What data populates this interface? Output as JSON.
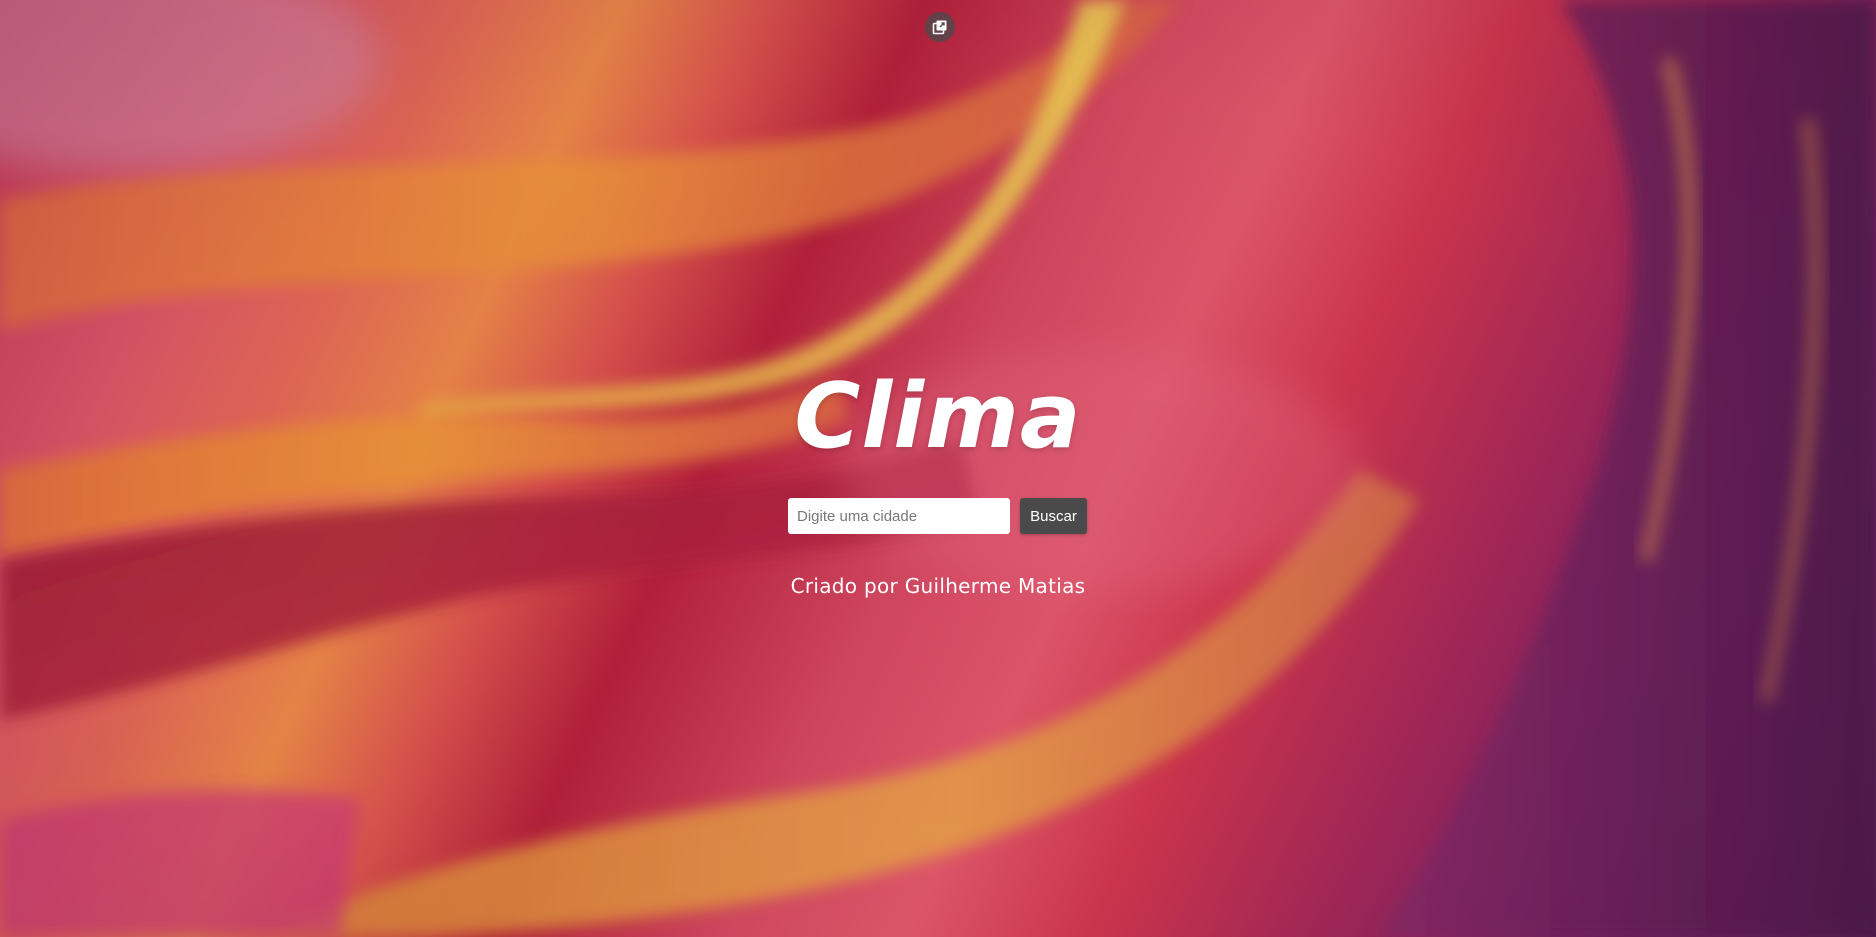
{
  "app": {
    "title": "Clima"
  },
  "search": {
    "placeholder": "Digite uma cidade",
    "value": "",
    "button_label": "Buscar"
  },
  "footer": {
    "credit": "Criado por Guilherme Matias"
  },
  "icons": {
    "top": "open-in-new-window-icon"
  },
  "colors": {
    "button_bg": "#4a4a4a",
    "text": "#ffffff"
  }
}
